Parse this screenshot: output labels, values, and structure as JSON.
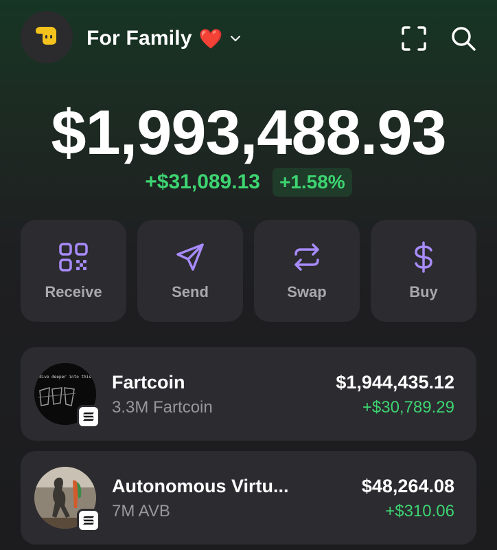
{
  "header": {
    "account_name": "For Family",
    "account_emoji": "❤️",
    "avatar_icon": "hand-pointing-icon",
    "icons": [
      "chevron-down-icon",
      "scan-icon",
      "search-icon"
    ]
  },
  "portfolio": {
    "balance": "$1,993,488.93",
    "change_abs": "+$31,089.13",
    "change_pct": "+1.58%"
  },
  "actions": [
    {
      "label": "Receive",
      "icon": "qr-code-icon"
    },
    {
      "label": "Send",
      "icon": "send-icon"
    },
    {
      "label": "Swap",
      "icon": "swap-icon"
    },
    {
      "label": "Buy",
      "icon": "dollar-icon"
    }
  ],
  "tokens": [
    {
      "name": "Fartcoin",
      "amount": "3.3M Fartcoin",
      "value": "$1,944,435.12",
      "change": "+$30,789.29",
      "image_caption": "dive deeper into this",
      "chain_icon": "solana-icon"
    },
    {
      "name": "Autonomous Virtu...",
      "amount": "7M AVB",
      "value": "$48,264.08",
      "change": "+$310.06",
      "chain_icon": "solana-icon"
    }
  ],
  "colors": {
    "positive": "#3dd471",
    "accent_purple": "#a78bfa",
    "card_bg": "#2c2b30"
  }
}
